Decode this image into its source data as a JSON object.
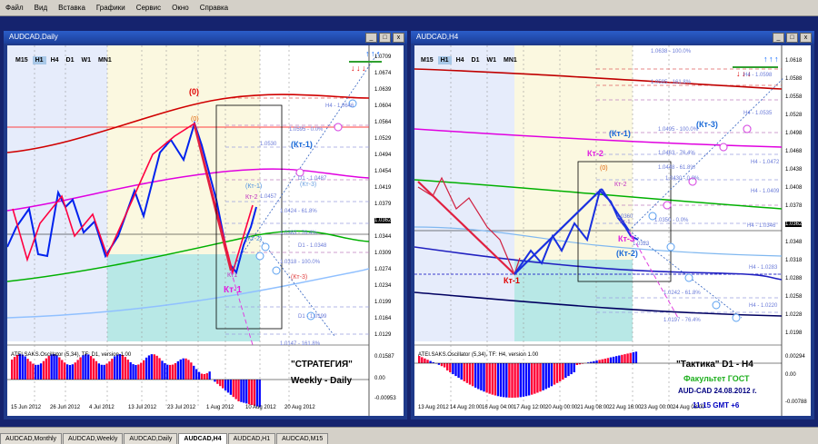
{
  "menu": [
    "Файл",
    "Вид",
    "Вставка",
    "Графики",
    "Сервис",
    "Окно",
    "Справка"
  ],
  "left": {
    "title": "AUDCAD,Daily",
    "timeframes": [
      "M15",
      "H1",
      "H4",
      "D1",
      "W1",
      "MN1"
    ],
    "active_tf": "H1",
    "price_labels": [
      "1.0709",
      "1.0674",
      "1.0639",
      "1.0604",
      "1.0564",
      "1.0529",
      "1.0494",
      "1.0454",
      "1.0419",
      "1.0379",
      "1.0362",
      "1.0344",
      "1.0309",
      "1.0274",
      "1.0234",
      "1.0199",
      "1.0164",
      "1.0129"
    ],
    "price_highlight": "1.0362",
    "price_red": "1.0599",
    "x_labels": [
      "15 Jun 2012",
      "26 Jun 2012",
      "4 Jul 2012",
      "13 Jul 2012",
      "23 Jul 2012",
      "1 Aug 2012",
      "10 Aug 2012",
      "20 Aug 2012"
    ],
    "osc_title": "ATEI.SAKS.Oscillator (5,34), TF: D1, version 1.00",
    "osc_labels": [
      "0.01587",
      "0.00",
      "-0.00953"
    ],
    "fib_labels": [
      "1.0595 - 0.0%",
      "1.0530",
      "1.0457",
      "1.0424 - 61.8%",
      "1.0383 - 76.4%",
      "D1 - 1.0487",
      "D1 - 1.0348",
      "1.0318 - 100.0%",
      "D1 - 1.0199",
      "1.0147 - 161.8%",
      "H4 - 1.0646"
    ],
    "annotations": {
      "zero_top": "(0)",
      "zero_mid": "(0)",
      "kt1_blue": "(Кт-1)",
      "kt3": "(Кт-3)",
      "kt1_small": "(Кт-1)",
      "kt2": "Кт-2",
      "kt2b": "(Кт-2)",
      "kt1_bottom": "Кт1",
      "kt1_big": "Кт-1",
      "kt3_red": "(Кт-3)",
      "strategy1": "\"СТРАТЕГИЯ\"",
      "strategy2": "Weekly - Daily"
    }
  },
  "right": {
    "title": "AUDCAD,H4",
    "timeframes": [
      "M15",
      "H1",
      "H4",
      "D1",
      "W1",
      "MN1"
    ],
    "active_tf": "H1",
    "price_labels": [
      "1.0618",
      "1.0588",
      "1.0558",
      "1.0528",
      "1.0498",
      "1.0468",
      "1.0438",
      "1.0408",
      "1.0378",
      "1.0362",
      "1.0348",
      "1.0318",
      "1.0288",
      "1.0258",
      "1.0228",
      "1.0198"
    ],
    "price_highlight": "1.0362",
    "price_blue": "1.0290",
    "x_labels": [
      "13 Aug 2012",
      "14 Aug 20:00",
      "16 Aug 04:00",
      "17 Aug 12:00",
      "20 Aug 00:00",
      "21 Aug 08:00",
      "22 Aug 16:00",
      "23 Aug 00:00",
      "24 Aug 08:00"
    ],
    "osc_title": "ATEI.SAKS.Oscillator (5,34), TF: H4, version 1.00",
    "osc_labels": [
      "0.00294",
      "0.00",
      "-0.00788"
    ],
    "fib_labels": [
      "1.0638 - 100.0%",
      "1.0585 - 161.8%",
      "H4 - 1.0598",
      "H4 - 1.0535",
      "1.0495 - 100.0%",
      "1.0463 - 76.4%",
      "H4 - 1.0472",
      "1.0448 - 61.8%",
      "1.0430 - 0.0%",
      "H4 - 1.0409",
      "1.0360",
      "1.0350 - 0.0%",
      "H4 - 1.0346",
      "1.0323",
      "H4 - 1.0283",
      "1.0242 - 61.8%",
      "H4 - 1.0220",
      "1.0197 - 76.4%"
    ],
    "annotations": {
      "kt3_top": "(Кт-3)",
      "kt1": "(Кт-1)",
      "kt2": "Кт-2",
      "zero": "(0)",
      "kt2_small": "Кт-2",
      "kt3": "Кт-3",
      "kt2_blue": "(Кт-2)",
      "kt1_red": "Кт-1",
      "kt1_tiny": "Кт-1",
      "tactic": "\"Тактика\"  D1 - H4",
      "faculty": "Факультет ГОСТ",
      "date": "AUD-CAD 24.08.2012  г.",
      "time": "11:15    GMT +6"
    }
  },
  "tabs": [
    "AUDCAD,Monthly",
    "AUDCAD,Weekly",
    "AUDCAD,Daily",
    "AUDCAD,H4",
    "AUDCAD,H1",
    "AUDCAD,M15"
  ],
  "active_tab": "AUDCAD,H4",
  "colors": {
    "bull_bar": "#ff0033",
    "bear_bar": "#0000ff",
    "price_line": "#0022ee",
    "zigzag": "#ff0040",
    "teal_zone": "#b8e8e6",
    "cream_zone": "#fbf8e0"
  }
}
